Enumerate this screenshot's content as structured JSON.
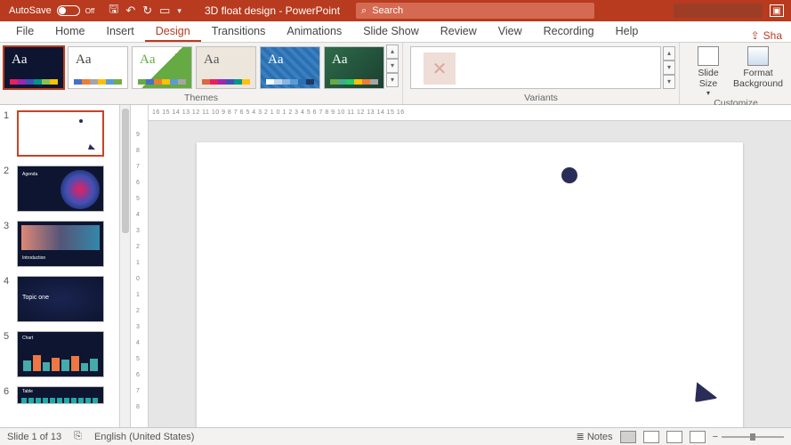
{
  "titlebar": {
    "autosave_label": "AutoSave",
    "autosave_state": "Off",
    "doc_title": "3D float design - PowerPoint",
    "search_placeholder": "Search",
    "share_label": "Sha"
  },
  "tabs": {
    "file": "File",
    "home": "Home",
    "insert": "Insert",
    "design": "Design",
    "transitions": "Transitions",
    "animations": "Animations",
    "slideshow": "Slide Show",
    "review": "Review",
    "view": "View",
    "recording": "Recording",
    "help": "Help"
  },
  "ribbon": {
    "themes_label": "Themes",
    "variants_label": "Variants",
    "customize_label": "Customize",
    "slide_size": "Slide Size",
    "format_bg": "Format Background",
    "theme_aa": "Aa"
  },
  "slides": {
    "s1": "1",
    "s2": "2",
    "s3": "3",
    "s4": "4",
    "s5": "5",
    "s6": "6",
    "thumb3_title": "Introduction",
    "thumb4_title": "Topic one",
    "thumb5_title": "Chart",
    "thumb6_title": "Table",
    "thumb2_title": "Agenda"
  },
  "ruler_h": "16  15  14  13  12  11  10  9  8  7  6  5  4  3  2  1  0  1  2  3  4  5  6  7  8  9  10  11  12  13  14  15  16",
  "status": {
    "slide_info": "Slide 1 of 13",
    "language": "English (United States)",
    "notes": "Notes"
  }
}
